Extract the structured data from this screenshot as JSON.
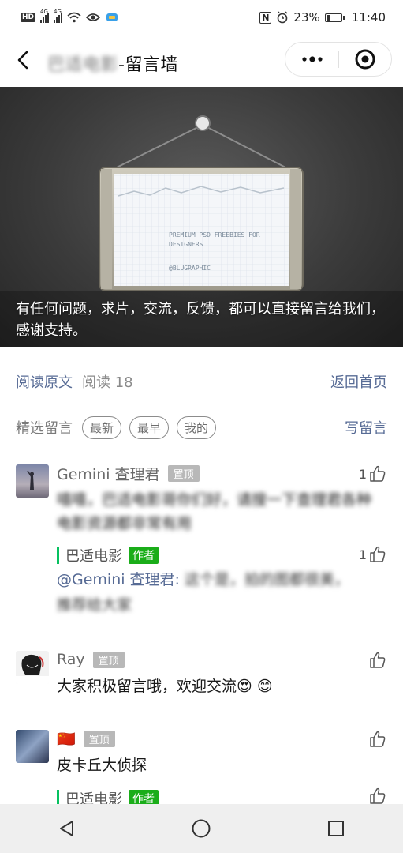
{
  "status_bar": {
    "network_badge": "HD",
    "sim1": "4G",
    "sim2": "4G",
    "nfc": "N",
    "battery": "23%",
    "battery_level": 0.23,
    "time": "11:40"
  },
  "nav": {
    "title_blurred": "巴适电影",
    "title_suffix": "-留言墙"
  },
  "cover": {
    "sign_line1": "PREMIUM PSD FREEBIES FOR",
    "sign_line2": "DESIGNERS",
    "sign_line3": "@BLUGRAPHIC",
    "caption": "有任何问题，求片，交流，反馈，都可以直接留言给我们，感谢支持。"
  },
  "meta": {
    "read_original": "阅读原文",
    "reads": "阅读 18",
    "back_home": "返回首页"
  },
  "featured": {
    "label": "精选留言",
    "filters": [
      "最新",
      "最早",
      "我的"
    ],
    "write": "写留言"
  },
  "comments": [
    {
      "name": "Gemini 查理君",
      "badge": "置顶",
      "likes": "1",
      "text": "嘻嘻，巴适电影哥你们好，请搜一下查理君各种电影资源都非常有用",
      "reply": {
        "author": "巴适电影",
        "badge": "作者",
        "likes": "1",
        "mention": "@Gemini 查理君:",
        "text": "这个是，拍的图都很美，推荐给大家"
      }
    },
    {
      "name": "Ray",
      "badge": "置顶",
      "likes": "",
      "text": "大家积极留言哦，欢迎交流😍 😊"
    },
    {
      "name": "🇨🇳",
      "badge": "置顶",
      "likes": "",
      "text": "皮卡丘大侦探",
      "reply": {
        "author": "巴适电影",
        "badge": "作者",
        "likes": ""
      }
    }
  ],
  "colors": {
    "link": "#576b95",
    "author_green": "#1aad19",
    "reply_bar": "#07c160"
  }
}
